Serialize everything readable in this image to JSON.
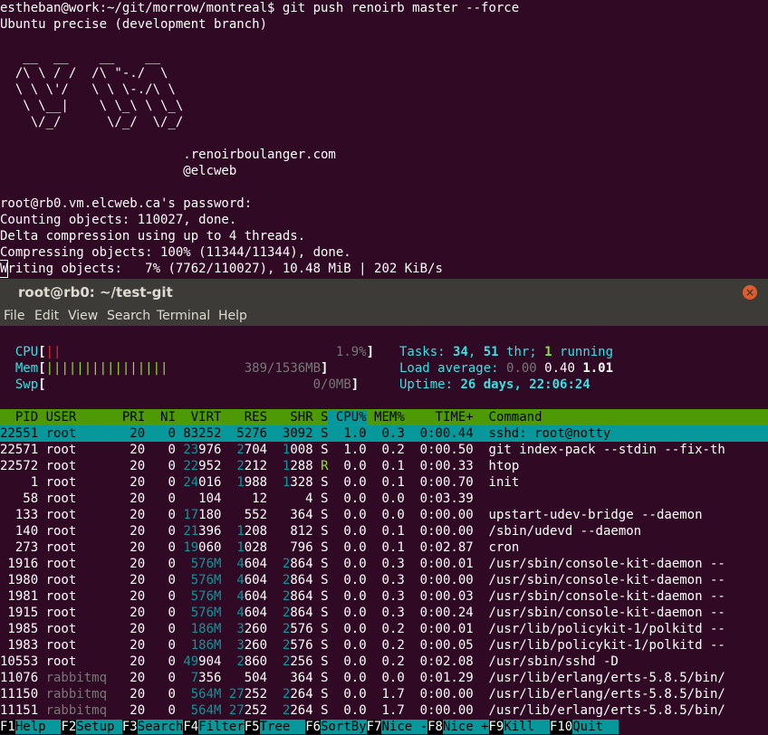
{
  "upper_terminal": {
    "lines": [
      "estheban@work:~/git/morrow/montreal$ git push renoirb master --force",
      "Ubuntu precise (development branch)",
      "",
      "   __  __    __    __",
      "  /\\ \\ / /  /\\ \"-./  \\",
      "  \\ \\ \\'/   \\ \\ \\-./\\ \\",
      "   \\ \\__|    \\ \\_\\ \\ \\_\\",
      "    \\/_/      \\/_/  \\/_/",
      "",
      "                        .renoirboulanger.com",
      "                        @elcweb",
      "",
      "root@rb0.vm.elcweb.ca's password:",
      "Counting objects: 110027, done.",
      "Delta compression using up to 4 threads.",
      "Compressing objects: 100% (11344/11344), done."
    ],
    "cursor_char": "W",
    "last_line_rest": "riting objects:   7% (7762/110027), 10.48 MiB | 202 KiB/s"
  },
  "window": {
    "title": "root@rb0: ~/test-git",
    "close_glyph": "×",
    "menu": [
      "File",
      "Edit",
      "View",
      "Search",
      "Terminal",
      "Help"
    ]
  },
  "htop": {
    "meters": {
      "cpu_label": "CPU",
      "cpu_bar": "||",
      "cpu_value": "1.9%",
      "mem_label": "Mem",
      "mem_bar": "||||||||||||||||",
      "mem_value": "389/1536MB",
      "swp_label": "Swp",
      "swp_bar": "",
      "swp_value": "0/0MB",
      "open_bracket": "[",
      "close_bracket": "]"
    },
    "tasks": {
      "label": "Tasks: ",
      "count": "34",
      "sep": ", ",
      "threads": "51",
      "thr_label": " thr; ",
      "running": "1",
      "running_label": " running"
    },
    "load": {
      "label": "Load average: ",
      "l1": "0.00",
      "l5": "0.40",
      "l15": "1.01"
    },
    "uptime": {
      "label": "Uptime: ",
      "value": "26 days, 22:06:24"
    },
    "columns": [
      "  PID",
      "USER     ",
      " PRI",
      "  NI",
      "  VIRT",
      "   RES",
      "   SHR",
      " S",
      " CPU%",
      " MEM%",
      "    TIME+ ",
      " Command"
    ],
    "rows": [
      {
        "pid": "22551",
        "user": "root",
        "pri": "20",
        "ni": "0",
        "virt": "83252",
        "res": "5276",
        "shr": "3092",
        "s": "S",
        "cpu": "1.0",
        "mem": "0.3",
        "time": "0:00.44",
        "cmd": "sshd: root@notty"
      },
      {
        "pid": "22571",
        "user": "root",
        "pri": "20",
        "ni": "0",
        "virt": "23976",
        "res": "2704",
        "shr": "1008",
        "s": "S",
        "cpu": "1.0",
        "mem": "0.2",
        "time": "0:00.50",
        "cmd": "git index-pack --stdin --fix-th"
      },
      {
        "pid": "22572",
        "user": "root",
        "pri": "20",
        "ni": "0",
        "virt": "22952",
        "res": "2212",
        "shr": "1288",
        "s": "R",
        "cpu": "0.0",
        "mem": "0.1",
        "time": "0:00.33",
        "cmd": "htop"
      },
      {
        "pid": "1",
        "user": "root",
        "pri": "20",
        "ni": "0",
        "virt": "24016",
        "res": "1988",
        "shr": "1328",
        "s": "S",
        "cpu": "0.0",
        "mem": "0.1",
        "time": "0:00.70",
        "cmd": "init"
      },
      {
        "pid": "58",
        "user": "root",
        "pri": "20",
        "ni": "0",
        "virt": "104",
        "res": "12",
        "shr": "4",
        "s": "S",
        "cpu": "0.0",
        "mem": "0.0",
        "time": "0:03.39",
        "cmd": ""
      },
      {
        "pid": "133",
        "user": "root",
        "pri": "20",
        "ni": "0",
        "virt": "17180",
        "res": "552",
        "shr": "364",
        "s": "S",
        "cpu": "0.0",
        "mem": "0.0",
        "time": "0:00.00",
        "cmd": "upstart-udev-bridge --daemon"
      },
      {
        "pid": "140",
        "user": "root",
        "pri": "20",
        "ni": "0",
        "virt": "21396",
        "res": "1208",
        "shr": "812",
        "s": "S",
        "cpu": "0.0",
        "mem": "0.1",
        "time": "0:00.00",
        "cmd": "/sbin/udevd --daemon"
      },
      {
        "pid": "273",
        "user": "root",
        "pri": "20",
        "ni": "0",
        "virt": "19060",
        "res": "1028",
        "shr": "796",
        "s": "S",
        "cpu": "0.0",
        "mem": "0.1",
        "time": "0:02.87",
        "cmd": "cron"
      },
      {
        "pid": "1916",
        "user": "root",
        "pri": "20",
        "ni": "0",
        "virt": "576M",
        "res": "4604",
        "shr": "2864",
        "s": "S",
        "cpu": "0.0",
        "mem": "0.3",
        "time": "0:00.01",
        "cmd": "/usr/sbin/console-kit-daemon --"
      },
      {
        "pid": "1980",
        "user": "root",
        "pri": "20",
        "ni": "0",
        "virt": "576M",
        "res": "4604",
        "shr": "2864",
        "s": "S",
        "cpu": "0.0",
        "mem": "0.3",
        "time": "0:00.00",
        "cmd": "/usr/sbin/console-kit-daemon --"
      },
      {
        "pid": "1981",
        "user": "root",
        "pri": "20",
        "ni": "0",
        "virt": "576M",
        "res": "4604",
        "shr": "2864",
        "s": "S",
        "cpu": "0.0",
        "mem": "0.3",
        "time": "0:00.03",
        "cmd": "/usr/sbin/console-kit-daemon --"
      },
      {
        "pid": "1915",
        "user": "root",
        "pri": "20",
        "ni": "0",
        "virt": "576M",
        "res": "4604",
        "shr": "2864",
        "s": "S",
        "cpu": "0.0",
        "mem": "0.3",
        "time": "0:00.24",
        "cmd": "/usr/sbin/console-kit-daemon --"
      },
      {
        "pid": "1985",
        "user": "root",
        "pri": "20",
        "ni": "0",
        "virt": "186M",
        "res": "3260",
        "shr": "2576",
        "s": "S",
        "cpu": "0.0",
        "mem": "0.2",
        "time": "0:00.01",
        "cmd": "/usr/lib/policykit-1/polkitd --"
      },
      {
        "pid": "1983",
        "user": "root",
        "pri": "20",
        "ni": "0",
        "virt": "186M",
        "res": "3260",
        "shr": "2576",
        "s": "S",
        "cpu": "0.0",
        "mem": "0.2",
        "time": "0:00.05",
        "cmd": "/usr/lib/policykit-1/polkitd --"
      },
      {
        "pid": "10553",
        "user": "root",
        "pri": "20",
        "ni": "0",
        "virt": "49904",
        "res": "2860",
        "shr": "2256",
        "s": "S",
        "cpu": "0.0",
        "mem": "0.2",
        "time": "0:02.08",
        "cmd": "/usr/sbin/sshd -D"
      },
      {
        "pid": "11076",
        "user": "rabbitmq",
        "pri": "20",
        "ni": "0",
        "virt": "7356",
        "res": "504",
        "shr": "364",
        "s": "S",
        "cpu": "0.0",
        "mem": "0.0",
        "time": "0:01.29",
        "cmd": "/usr/lib/erlang/erts-5.8.5/bin/"
      },
      {
        "pid": "11150",
        "user": "rabbitmq",
        "pri": "20",
        "ni": "0",
        "virt": "564M",
        "res": "27252",
        "shr": "2264",
        "s": "S",
        "cpu": "0.0",
        "mem": "1.7",
        "time": "0:00.00",
        "cmd": "/usr/lib/erlang/erts-5.8.5/bin/"
      },
      {
        "pid": "11151",
        "user": "rabbitmq",
        "pri": "20",
        "ni": "0",
        "virt": "564M",
        "res": "27252",
        "shr": "2264",
        "s": "S",
        "cpu": "0.0",
        "mem": "1.7",
        "time": "0:00.00",
        "cmd": "/usr/lib/erlang/erts-5.8.5/bin/"
      }
    ],
    "fkeys": [
      {
        "key": "F1",
        "label": "Help  "
      },
      {
        "key": "F2",
        "label": "Setup "
      },
      {
        "key": "F3",
        "label": "Search"
      },
      {
        "key": "F4",
        "label": "Filter"
      },
      {
        "key": "F5",
        "label": "Tree  "
      },
      {
        "key": "F6",
        "label": "SortBy"
      },
      {
        "key": "F7",
        "label": "Nice -"
      },
      {
        "key": "F8",
        "label": "Nice +"
      },
      {
        "key": "F9",
        "label": "Kill  "
      },
      {
        "key": "F10",
        "label": "Quit  "
      }
    ]
  },
  "colors": {
    "background": "#300a24",
    "titlebar": "#3c3b37",
    "header_green": "#4e9a06",
    "selection_cyan": "#06989a",
    "cyan_text": "#34e2e2"
  }
}
